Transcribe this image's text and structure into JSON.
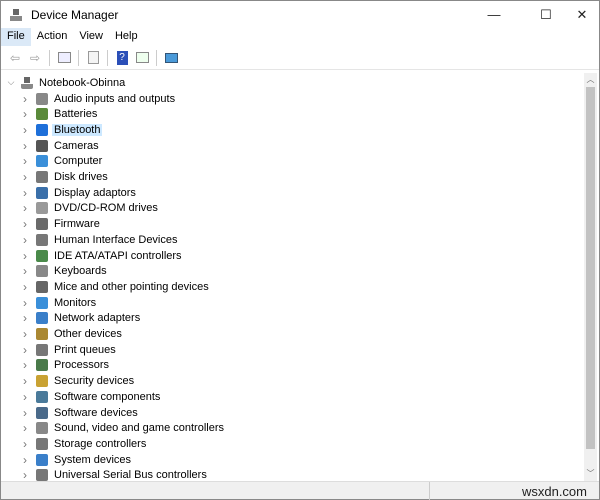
{
  "window": {
    "title": "Device Manager",
    "minimize": "—",
    "maximize": "☐",
    "close": "✕"
  },
  "menu": [
    "File",
    "Action",
    "View",
    "Help"
  ],
  "toolbar": [
    "back-icon",
    "forward-icon",
    "show-hide-console-tree-icon",
    "properties-icon",
    "help-icon",
    "run-action-icon",
    "scan-hardware-icon"
  ],
  "tree": {
    "root": "Notebook-Obinna",
    "selected": "Bluetooth",
    "items": [
      {
        "label": "Audio inputs and outputs",
        "color": "#888888"
      },
      {
        "label": "Batteries",
        "color": "#5a8a3a"
      },
      {
        "label": "Bluetooth",
        "color": "#1e6fd9"
      },
      {
        "label": "Cameras",
        "color": "#555555"
      },
      {
        "label": "Computer",
        "color": "#3a8fd9"
      },
      {
        "label": "Disk drives",
        "color": "#777777"
      },
      {
        "label": "Display adaptors",
        "color": "#3a6fa9"
      },
      {
        "label": "DVD/CD-ROM drives",
        "color": "#999999"
      },
      {
        "label": "Firmware",
        "color": "#6a6a6a"
      },
      {
        "label": "Human Interface Devices",
        "color": "#777777"
      },
      {
        "label": "IDE ATA/ATAPI controllers",
        "color": "#4a8a4a"
      },
      {
        "label": "Keyboards",
        "color": "#888888"
      },
      {
        "label": "Mice and other pointing devices",
        "color": "#666666"
      },
      {
        "label": "Monitors",
        "color": "#3a8fd9"
      },
      {
        "label": "Network adapters",
        "color": "#3a7fc9"
      },
      {
        "label": "Other devices",
        "color": "#aa8833"
      },
      {
        "label": "Print queues",
        "color": "#777777"
      },
      {
        "label": "Processors",
        "color": "#4a7a4a"
      },
      {
        "label": "Security devices",
        "color": "#c9a233"
      },
      {
        "label": "Software components",
        "color": "#4a7a9a"
      },
      {
        "label": "Software devices",
        "color": "#4a6a8a"
      },
      {
        "label": "Sound, video and game controllers",
        "color": "#888888"
      },
      {
        "label": "Storage controllers",
        "color": "#777777"
      },
      {
        "label": "System devices",
        "color": "#3a7fc9"
      },
      {
        "label": "Universal Serial Bus controllers",
        "color": "#777777"
      }
    ]
  },
  "status": {
    "watermark": "wsxdn.com"
  }
}
